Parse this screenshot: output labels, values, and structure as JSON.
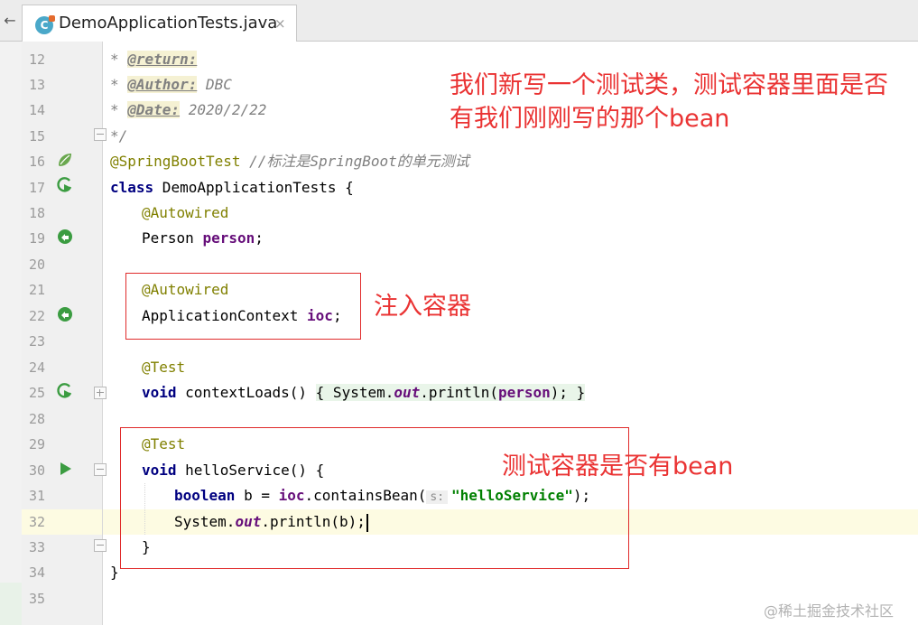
{
  "tab": {
    "icon_letter": "C",
    "filename": "DemoApplicationTests.java",
    "close_symbol": "×"
  },
  "nav": {
    "back_symbol": "←"
  },
  "line_numbers": [
    "12",
    "13",
    "14",
    "15",
    "16",
    "17",
    "18",
    "19",
    "20",
    "21",
    "22",
    "23",
    "24",
    "25",
    "28",
    "29",
    "30",
    "31",
    "32",
    "33",
    "34",
    "35"
  ],
  "code": {
    "l12": {
      "star": "* ",
      "tag": "@return:"
    },
    "l13": {
      "star": "* ",
      "tag": "@Author:",
      "text": " DBC"
    },
    "l14": {
      "star": "* ",
      "tag": "@Date:",
      "text": " 2020/2/22"
    },
    "l15": {
      "text": "*/"
    },
    "l16": {
      "annotation": "@SpringBootTest",
      "comment": " //标注是SpringBoot的单元测试"
    },
    "l17": {
      "kw": "class",
      "rest": " DemoApplicationTests {"
    },
    "l18": {
      "annotation": "@Autowired"
    },
    "l19": {
      "type": "Person ",
      "field": "person",
      "end": ";"
    },
    "l21": {
      "annotation": "@Autowired"
    },
    "l22": {
      "type": "ApplicationContext ",
      "field": "ioc",
      "end": ";"
    },
    "l24": {
      "annotation": "@Test"
    },
    "l25": {
      "kw": "void",
      "name": " contextLoads() ",
      "brace_open": "{",
      "sys": " System.",
      "out": "out",
      "call": ".println(",
      "arg": "person",
      "close": ");",
      "brace_close": " }"
    },
    "l29": {
      "annotation": "@Test"
    },
    "l30": {
      "kw": "void",
      "rest": " helloService() {"
    },
    "l31": {
      "kw": "boolean",
      "mid": " b = ",
      "field": "ioc",
      "call": ".containsBean(",
      "hint": "s:",
      "str": "\"helloService\"",
      "end": ");"
    },
    "l32": {
      "sys": "System.",
      "out": "out",
      "rest": ".println(b);"
    },
    "l33": {
      "text": "}"
    },
    "l34": {
      "text": "}"
    }
  },
  "annotations": {
    "note_top_1": "我们新写一个测试类，测试容器里面是否",
    "note_top_2": "有我们刚刚写的那个bean",
    "note_inject": "注入容器",
    "note_bean": "测试容器是否有bean"
  },
  "watermark": "@稀土掘金技术社区",
  "colors": {
    "keyword": "#000080",
    "annotation": "#808000",
    "comment": "#808080",
    "field": "#660e7a",
    "string": "#008000",
    "note_red": "#ea3333",
    "current_line": "#fdfbe2",
    "run_icon_green": "#3b9c41"
  },
  "icons": [
    "spring-bean-icon",
    "run-test-icon",
    "autowired-navigate-icon",
    "run-arrow-icon",
    "fold-icon",
    "class-file-icon"
  ]
}
